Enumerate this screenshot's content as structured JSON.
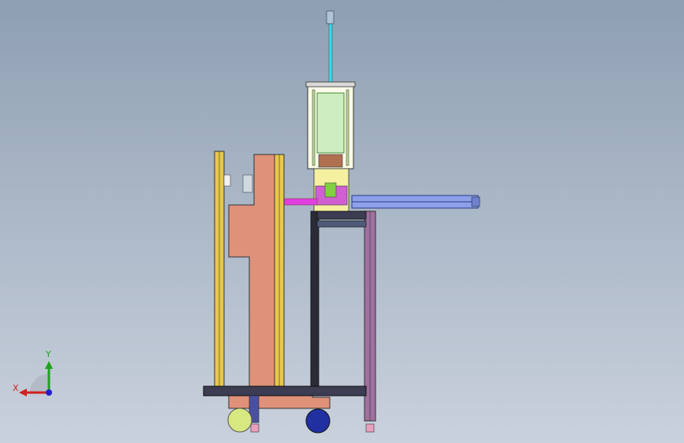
{
  "viewport": {
    "background_top": "#8e9fb2",
    "background_bottom": "#c9d1dc"
  },
  "triad": {
    "x_label": "X",
    "y_label": "Y",
    "x_color": "#d02020",
    "y_color": "#20a020",
    "z_color": "#2020d0"
  },
  "model": {
    "colors": {
      "salmon_body": "#e0917a",
      "yellow_rail": "#e8c84a",
      "magenta": "#e040e0",
      "cyan_rod": "#40d8e8",
      "pale_yellow": "#f4f0a0",
      "dark_frame": "#2a2a38",
      "purple_leg": "#a070a0",
      "blue_arm": "#5060d0",
      "green_part": "#80d040",
      "light_green_wheel": "#d8e880",
      "dark_blue_wheel": "#2030a0"
    }
  }
}
